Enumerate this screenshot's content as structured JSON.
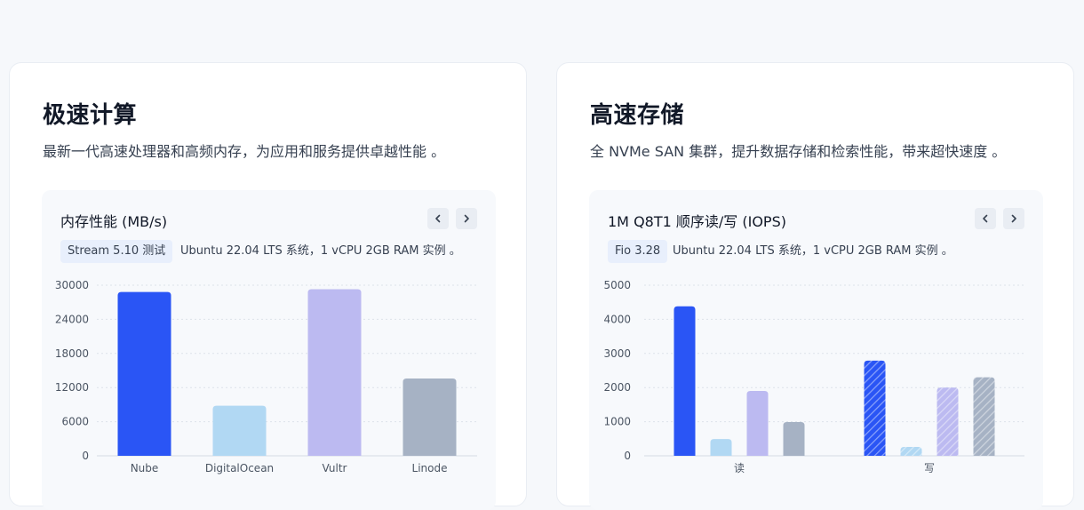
{
  "cards": [
    {
      "title": "极速计算",
      "description": "最新一代高速处理器和高频内存，为应用和服务提供卓越性能 。",
      "chart": {
        "title": "内存性能 (MB/s)",
        "tag": "Stream 5.10 测试",
        "note": "Ubuntu 22.04 LTS 系统，1 vCPU 2GB RAM 实例 。"
      }
    },
    {
      "title": "高速存储",
      "description": "全 NVMe SAN 集群，提升数据存储和检索性能，带来超快速度 。",
      "chart": {
        "title": "1M Q8T1 顺序读/写 (IOPS)",
        "tag": "Fio 3.28",
        "note": "Ubuntu 22.04 LTS 系统，1 vCPU 2GB RAM 实例 。"
      }
    }
  ],
  "icons": {
    "prev": "chevron-left-icon",
    "next": "chevron-right-icon"
  },
  "colors": {
    "nube": "#2a55f5",
    "digitalocean": "#b1d8f3",
    "vultr": "#bcbaf1",
    "linode": "#a6b2c4"
  },
  "chart_data": [
    {
      "type": "bar",
      "categories": [
        "Nube",
        "DigitalOcean",
        "Vultr",
        "Linode"
      ],
      "values": [
        28800,
        8800,
        29300,
        13600
      ],
      "ylim": [
        0,
        30000
      ],
      "yticks": [
        0,
        6000,
        12000,
        18000,
        24000,
        30000
      ],
      "grid": true
    },
    {
      "type": "bar",
      "categories": [
        "读",
        "写"
      ],
      "series": [
        {
          "values": [
            4380,
            2790
          ],
          "color": "#2a55f5"
        },
        {
          "values": [
            490,
            260
          ],
          "color": "#b1d8f3"
        },
        {
          "values": [
            1900,
            2000
          ],
          "color": "#bcbaf1"
        },
        {
          "values": [
            990,
            2300
          ],
          "color": "#a6b2c4"
        }
      ],
      "hatched_category": "写",
      "ylim": [
        0,
        5000
      ],
      "yticks": [
        0,
        1000,
        2000,
        3000,
        4000,
        5000
      ],
      "grid": true
    }
  ]
}
